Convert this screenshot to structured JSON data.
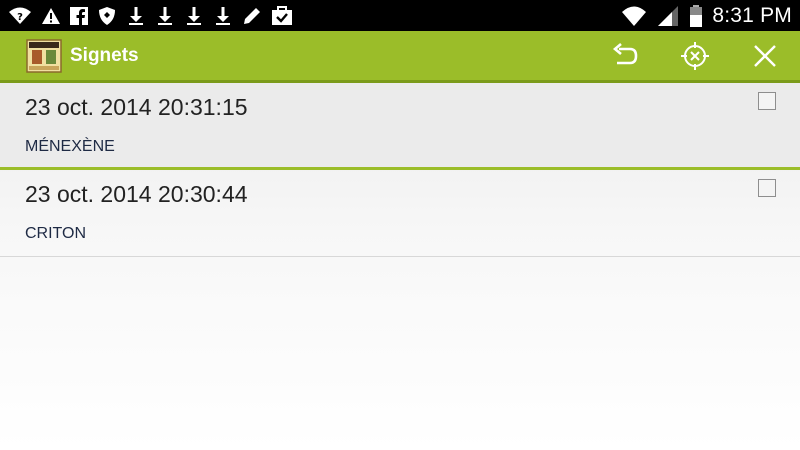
{
  "status_bar": {
    "time": "8:31 PM",
    "left_icons": [
      "wifi-question-icon",
      "warning-icon",
      "facebook-icon",
      "shield-icon",
      "download-icon",
      "download-icon",
      "download-icon",
      "download-icon",
      "pencil-icon",
      "briefcase-check-icon"
    ],
    "right_icons": [
      "wifi-icon",
      "signal-icon",
      "battery-icon"
    ]
  },
  "action_bar": {
    "title": "Signets",
    "background": "#9bbd29",
    "actions": [
      "undo-icon",
      "crosshair-icon",
      "close-icon"
    ]
  },
  "bookmarks": [
    {
      "date": "23 oct. 2014 20:31:15",
      "name": "MÉNEXÈNE",
      "checked": false,
      "selected": true
    },
    {
      "date": "23 oct. 2014 20:30:44",
      "name": "CRITON",
      "checked": false,
      "selected": false
    }
  ]
}
